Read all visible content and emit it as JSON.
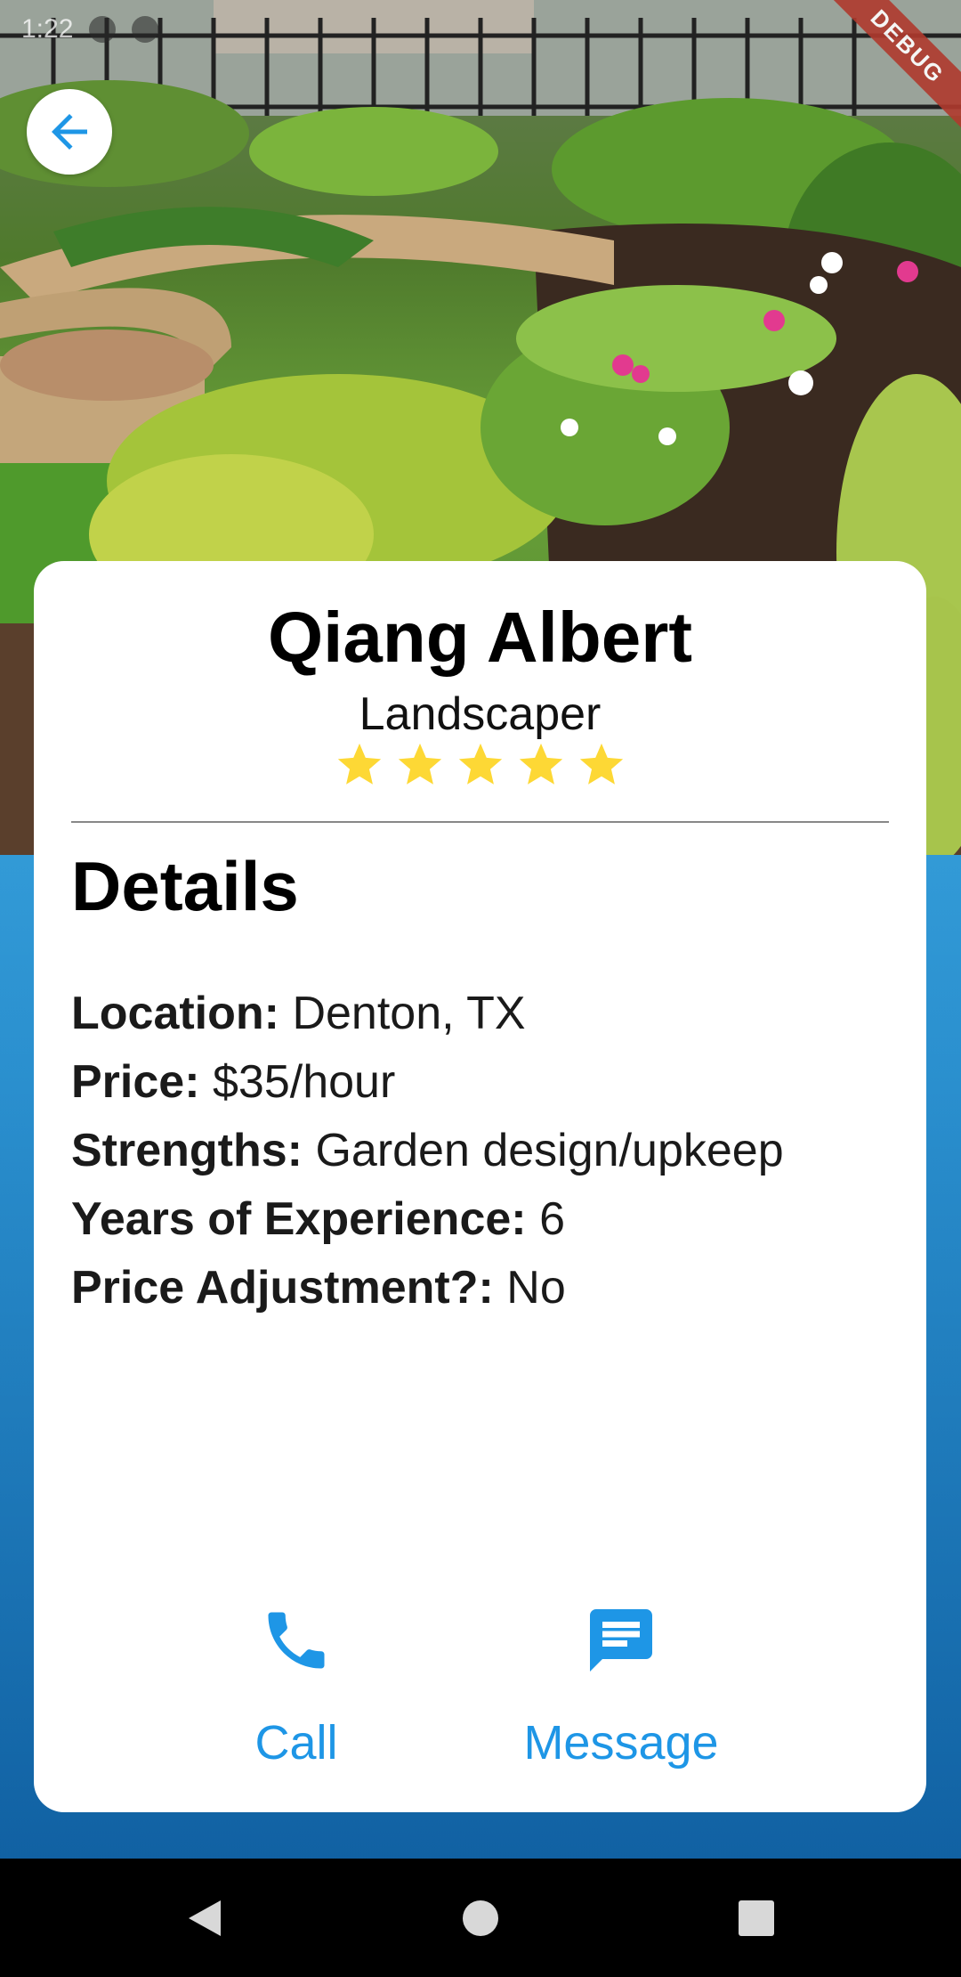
{
  "status_bar": {
    "time": "1:22"
  },
  "debug_banner": {
    "label": "DEBUG"
  },
  "back_button": {
    "icon": "arrow-left-icon",
    "color": "#1e96e6"
  },
  "profile": {
    "name": "Qiang Albert",
    "role": "Landscaper",
    "rating": {
      "value": 5,
      "max": 5,
      "star_color": "#fdd835"
    }
  },
  "details": {
    "heading": "Details",
    "items": [
      {
        "label": "Location:",
        "value": "Denton, TX"
      },
      {
        "label": "Price:",
        "value": "$35/hour"
      },
      {
        "label": "Strengths:",
        "value": "Garden design/upkeep"
      },
      {
        "label": "Years of Experience:",
        "value": "6"
      },
      {
        "label": "Price Adjustment?:",
        "value": "No"
      }
    ]
  },
  "actions": {
    "call": {
      "label": "Call",
      "icon": "phone-icon"
    },
    "message": {
      "label": "Message",
      "icon": "message-icon"
    },
    "accent_color": "#1e96e6"
  },
  "system_nav": {
    "back": "back-icon",
    "home": "home-icon",
    "recents": "recents-icon"
  }
}
